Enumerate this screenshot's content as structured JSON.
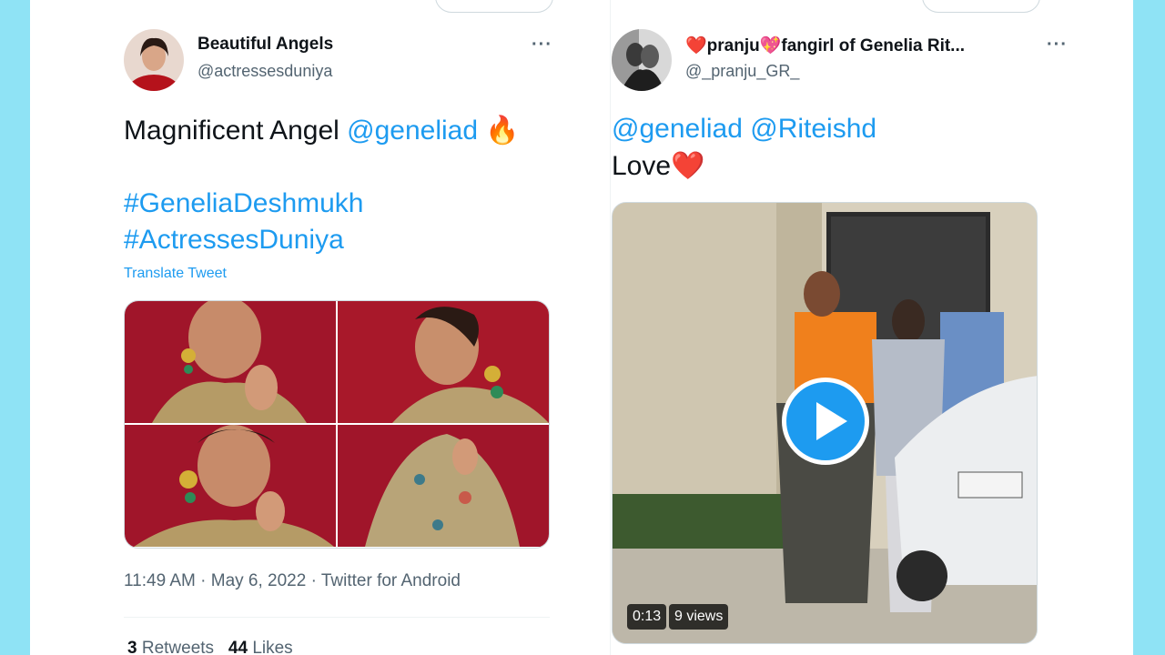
{
  "left_tweet": {
    "display_name": "Beautiful Angels",
    "handle": "@actressesduniya",
    "more": "···",
    "text_prefix": "Magnificent Angel ",
    "mention": "@geneliad",
    "emoji": "🔥",
    "hashtag1": "#GeneliaDeshmukh",
    "hashtag2": "#ActressesDuniya",
    "translate": "Translate Tweet",
    "timestamp": "11:49 AM · May 6, 2022 · Twitter for Android",
    "retweets_count": "3",
    "retweets_label": " Retweets",
    "likes_count": "44",
    "likes_label": " Likes"
  },
  "right_tweet": {
    "display_name": "❤️pranju💖fangirl of Genelia Rit...",
    "handle": "@_pranju_GR_",
    "more": "···",
    "mention1": "@geneliad",
    "mention2": "@Riteishd",
    "text_love": "Love",
    "heart": "❤️",
    "video_duration": "0:13",
    "video_views": "9 views"
  },
  "colors": {
    "background": "#8fe3f5",
    "link": "#1d9bf0",
    "secondary_text": "#536471"
  }
}
